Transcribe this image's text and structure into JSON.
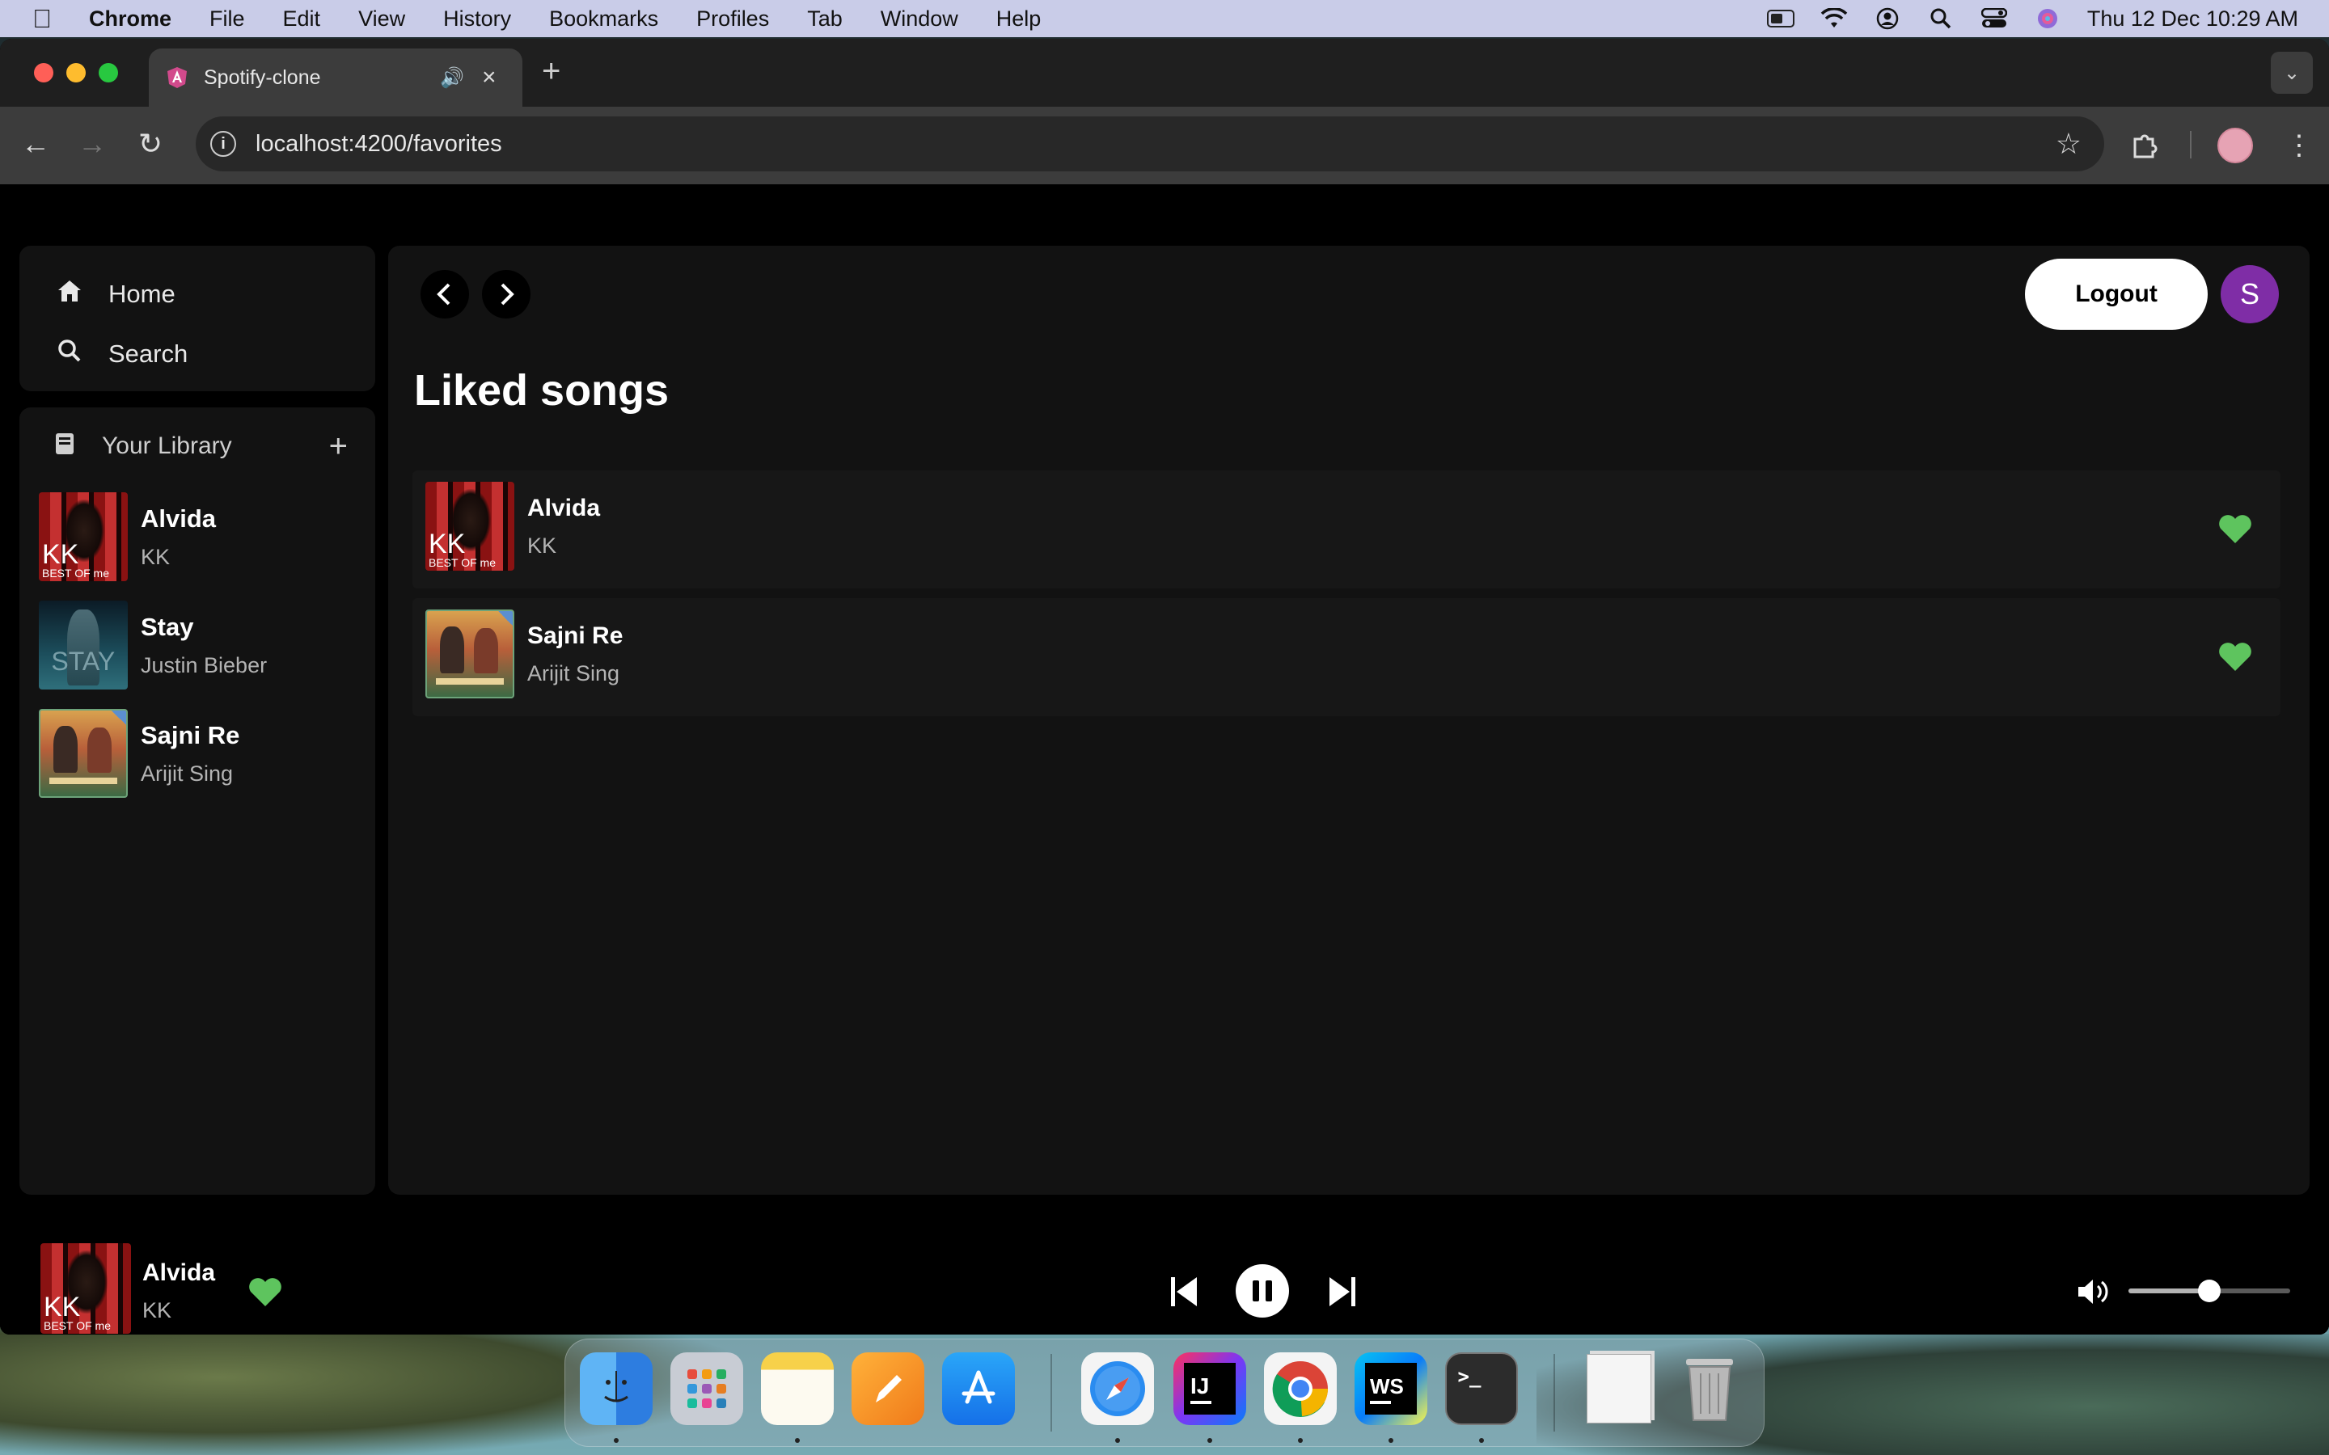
{
  "menubar": {
    "app_name": "Chrome",
    "items": [
      "File",
      "Edit",
      "View",
      "History",
      "Bookmarks",
      "Profiles",
      "Tab",
      "Window",
      "Help"
    ],
    "datetime": "Thu 12 Dec  10:29 AM"
  },
  "browser": {
    "tab_title": "Spotify-clone",
    "url": "localhost:4200/favorites"
  },
  "sidebar": {
    "nav": [
      {
        "label": "Home",
        "icon": "home-icon"
      },
      {
        "label": "Search",
        "icon": "search-icon"
      }
    ],
    "library_title": "Your Library",
    "library_items": [
      {
        "title": "Alvida",
        "artist": "KK"
      },
      {
        "title": "Stay",
        "artist": "Justin Bieber"
      },
      {
        "title": "Sajni Re",
        "artist": "Arijit Sing"
      }
    ]
  },
  "header": {
    "logout_label": "Logout",
    "avatar_letter": "S"
  },
  "main": {
    "title": "Liked songs",
    "songs": [
      {
        "title": "Alvida",
        "artist": "KK",
        "liked": true
      },
      {
        "title": "Sajni Re",
        "artist": "Arijit Sing",
        "liked": true
      }
    ]
  },
  "player": {
    "title": "Alvida",
    "artist": "KK",
    "liked": true,
    "state": "playing",
    "volume": 0.5
  },
  "art_labels": {
    "kk_big": "KK",
    "kk_small": "BEST OF me",
    "stay": "STAY"
  },
  "colors": {
    "accent_green": "#5ec45e",
    "avatar_purple": "#7f2da6",
    "panel": "#121212",
    "row": "#171717"
  },
  "dock": {
    "apps": [
      "Finder",
      "Launchpad",
      "Notes",
      "Pages",
      "App Store",
      "Safari",
      "IntelliJ IDEA",
      "Chrome",
      "WebStorm",
      "Terminal",
      "Documents",
      "Trash"
    ],
    "labels": {
      "intellij": "IJ",
      "webstorm": "WS",
      "terminal": ">_"
    }
  }
}
